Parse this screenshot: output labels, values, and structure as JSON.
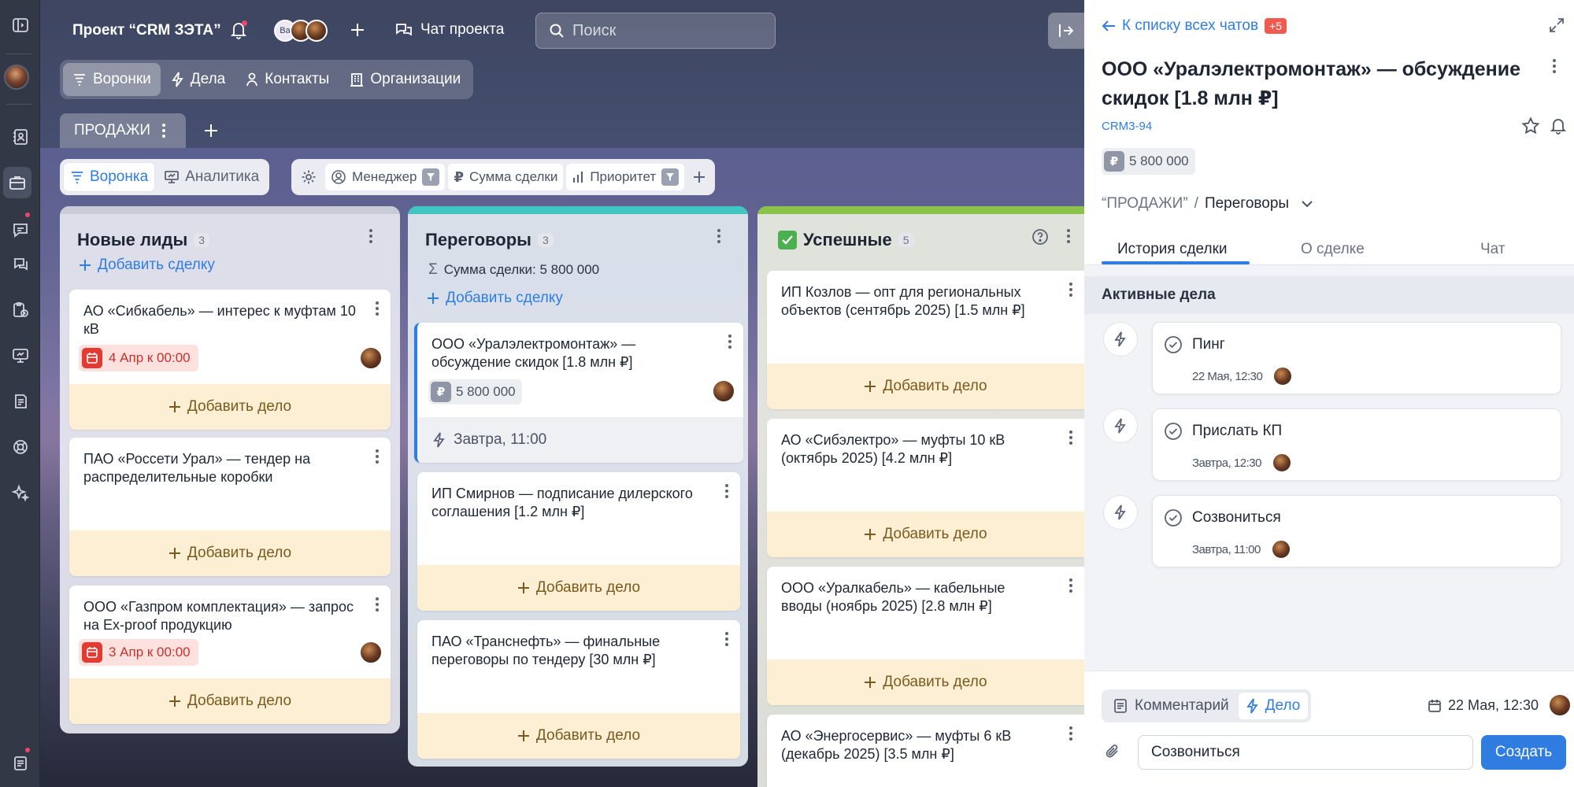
{
  "header": {
    "project_title": "Проект “CRM ЗЭТА”",
    "avatar_initials": "Ba",
    "project_chat": "Чат проекта",
    "search_placeholder": "Поиск"
  },
  "nav": [
    "Воронки",
    "Дела",
    "Контакты",
    "Организации"
  ],
  "pipeline_tab": "ПРОДАЖИ",
  "toolbar": {
    "funnel": "Воронка",
    "analytics": "Аналитика",
    "filters": [
      "Менеджер",
      "Сумма сделки",
      "Приоритет"
    ]
  },
  "columns": [
    {
      "title": "Новые лиды",
      "count": "3",
      "add_deal": "Добавить сделку",
      "color": "#c9ccd6",
      "cards": [
        {
          "title": "АО «Сибкабель» — интерес к муфтам 10 кВ",
          "date": "4 Апр к 00:00",
          "add_task": "Добавить дело"
        },
        {
          "title": "ПАО «Россети Урал» — тендер на распределительные коробки",
          "add_task": "Добавить дело"
        },
        {
          "title": "ООО «Газпром комплектация» — запрос на Ex-proof продукцию",
          "date": "3 Апр к 00:00",
          "add_task": "Добавить дело"
        }
      ]
    },
    {
      "title": "Переговоры",
      "count": "3",
      "sum": "Сумма сделки: 5 800 000",
      "add_deal": "Добавить сделку",
      "color": "#3fc6c0",
      "cards": [
        {
          "title": "ООО «Уралэлектромонтаж» — обсуждение скидок [1.8 млн ₽]",
          "amount": "5 800 000",
          "task": "Завтра, 11:00"
        },
        {
          "title": "ИП Смирнов — подписание дилерского соглашения [1.2 млн ₽]",
          "add_task": "Добавить дело"
        },
        {
          "title": "ПАО «Транснефть» — финальные переговоры по тендеру [30 млн ₽]",
          "add_task": "Добавить дело"
        }
      ]
    },
    {
      "title": "Успешные",
      "count": "5",
      "color": "#8bc34a",
      "cards": [
        {
          "title": "ИП Козлов — опт для региональных объектов (сентябрь 2025) [1.5 млн ₽]",
          "add_task": "Добавить дело"
        },
        {
          "title": "АО «Сибэлектро» — муфты 10 кВ (октябрь 2025) [4.2 млн ₽]",
          "add_task": "Добавить дело"
        },
        {
          "title": "ООО «Уралкабель» — кабельные вводы (ноябрь 2025) [2.8 млн ₽]",
          "add_task": "Добавить дело"
        },
        {
          "title": "АО «Энергосервис» — муфты 6 кВ (декабрь 2025) [3.5 млн ₽]"
        }
      ]
    }
  ],
  "panel": {
    "back_link": "К списку всех чатов",
    "unread": "+5",
    "title": "ООО «Уралэлектромонтаж» — обсуждение скидок [1.8 млн ₽]",
    "deal_id": "CRM3-94",
    "amount": "5 800 000",
    "pipeline": "“ПРОДАЖИ”",
    "stage": "Переговоры",
    "tabs": [
      "История сделки",
      "О сделке",
      "Чат"
    ],
    "section": "Активные дела",
    "activities": [
      {
        "title": "Пинг",
        "time": "22 Мая, 12:30"
      },
      {
        "title": "Прислать КП",
        "time": "Завтра, 12:30"
      },
      {
        "title": "Созвониться",
        "time": "Завтра, 11:00"
      }
    ],
    "composer": {
      "comment": "Комментарий",
      "task": "Дело",
      "date": "22 Мая, 12:30",
      "input_value": "Созвониться",
      "create": "Создать"
    }
  },
  "colors": {
    "accent": "#2f7de1",
    "danger": "#e23b33",
    "warm": "#fcefd3"
  }
}
